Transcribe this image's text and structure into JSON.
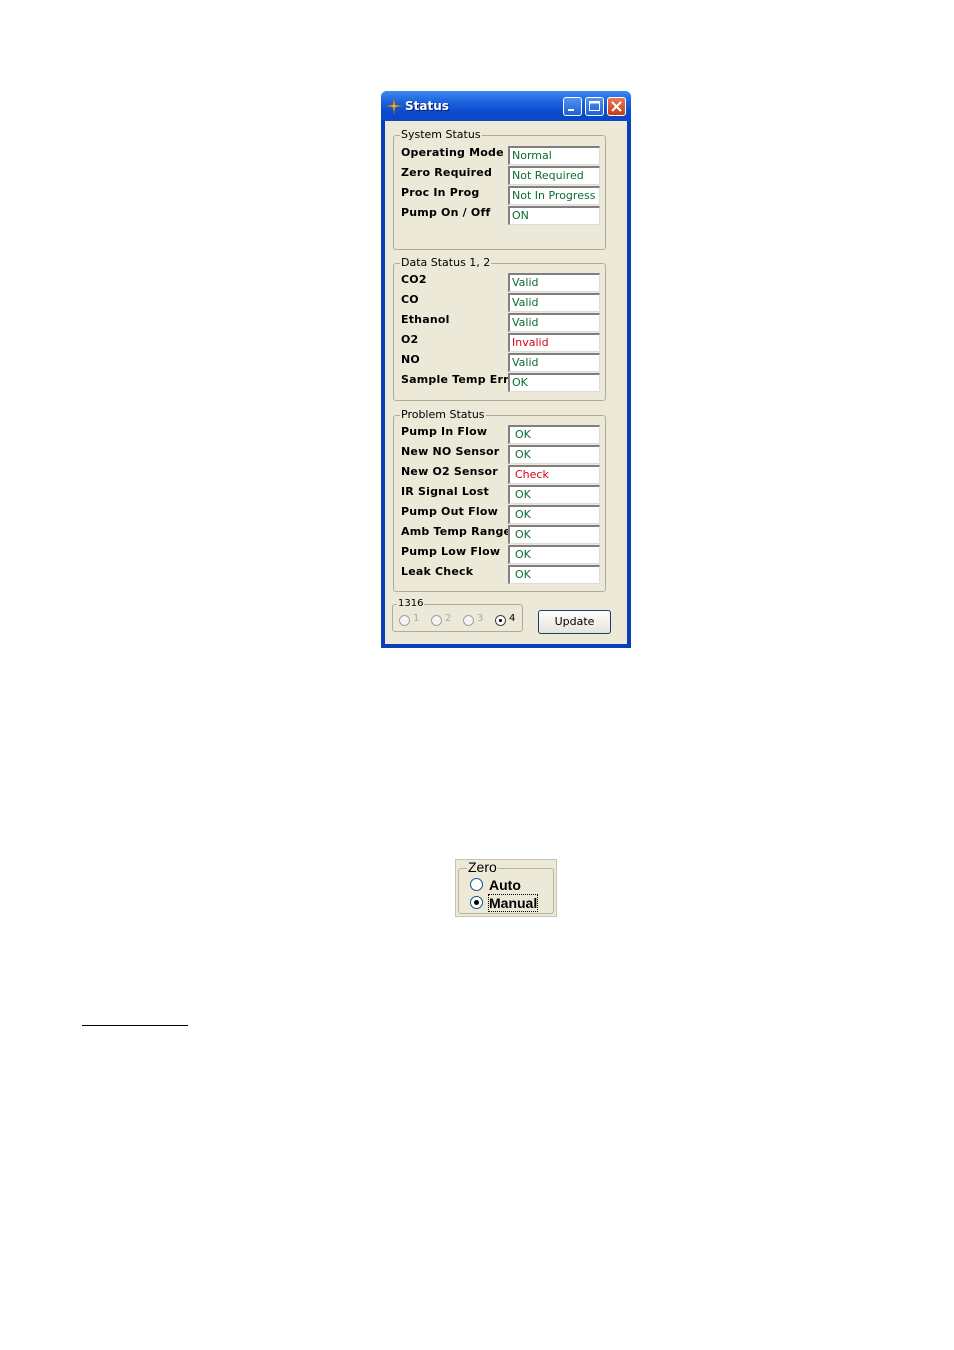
{
  "window": {
    "title": "Status",
    "icon": "status-icon",
    "controls": [
      "minimize-icon",
      "maximize-icon",
      "close-icon"
    ]
  },
  "colors": {
    "ok_text": "#0b6b2e",
    "error_text": "#d6001c",
    "titlebar": "#0a4ad0"
  },
  "system_status": {
    "title": "System Status",
    "rows": [
      {
        "label": "Operating Mode",
        "value": "Normal",
        "status": "ok"
      },
      {
        "label": "Zero Required",
        "value": "Not Required",
        "status": "ok"
      },
      {
        "label": "Proc In Prog",
        "value": "Not In Progress",
        "status": "ok"
      },
      {
        "label": "Pump On / Off",
        "value": "ON",
        "status": "ok"
      }
    ]
  },
  "data_status": {
    "title": "Data Status 1, 2",
    "rows": [
      {
        "label": "CO2",
        "value": "Valid",
        "status": "ok"
      },
      {
        "label": "CO",
        "value": "Valid",
        "status": "ok"
      },
      {
        "label": "Ethanol",
        "value": "Valid",
        "status": "ok"
      },
      {
        "label": "O2",
        "value": "Invalid",
        "status": "error"
      },
      {
        "label": "NO",
        "value": "Valid",
        "status": "ok"
      },
      {
        "label": "Sample Temp Err",
        "value": "OK",
        "status": "ok"
      }
    ]
  },
  "problem_status": {
    "title": "Problem Status",
    "rows": [
      {
        "label": "Pump In Flow",
        "value": "OK",
        "status": "ok"
      },
      {
        "label": "New NO Sensor",
        "value": "OK",
        "status": "ok"
      },
      {
        "label": "New O2 Sensor",
        "value": "Check",
        "status": "error"
      },
      {
        "label": "IR Signal Lost",
        "value": "OK",
        "status": "ok"
      },
      {
        "label": "Pump Out Flow",
        "value": "OK",
        "status": "ok"
      },
      {
        "label": "Amb Temp Range",
        "value": "OK",
        "status": "ok"
      },
      {
        "label": "Pump Low Flow",
        "value": "OK",
        "status": "ok"
      },
      {
        "label": "Leak Check",
        "value": "OK",
        "status": "ok"
      }
    ]
  },
  "device_selector": {
    "title": "1316",
    "options": [
      "1",
      "2",
      "3",
      "4"
    ],
    "selected": "4"
  },
  "update_button": "Update",
  "zero_group": {
    "title": "Zero",
    "options": [
      "Auto",
      "Manual"
    ],
    "selected": "Manual"
  }
}
